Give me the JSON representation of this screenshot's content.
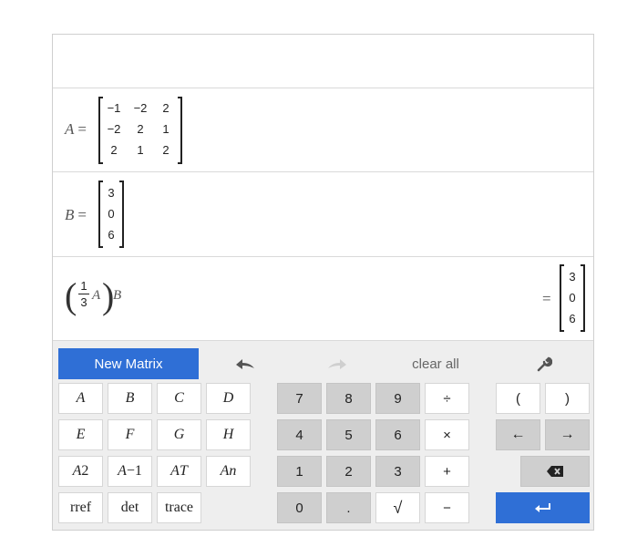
{
  "expressions": {
    "row1": {
      "name": "A",
      "equals": "=",
      "matrix": [
        [
          "−1",
          "−2",
          "2"
        ],
        [
          "−2",
          "2",
          "1"
        ],
        [
          "2",
          "1",
          "2"
        ]
      ]
    },
    "row2": {
      "name": "B",
      "equals": "=",
      "matrix": [
        [
          "3"
        ],
        [
          "0"
        ],
        [
          "6"
        ]
      ]
    },
    "row3": {
      "frac_num": "1",
      "frac_den": "3",
      "inner_var": "A",
      "outer_var": "B",
      "equals": "=",
      "result": [
        [
          "3"
        ],
        [
          "0"
        ],
        [
          "6"
        ]
      ]
    }
  },
  "toolbar": {
    "new_matrix": "New Matrix",
    "clear_all": "clear all"
  },
  "keys": {
    "A": "A",
    "B": "B",
    "C": "C",
    "D": "D",
    "E": "E",
    "F": "F",
    "G": "G",
    "H": "H",
    "A2_base": "A",
    "A2_sup": "2",
    "Ainv_base": "A",
    "Ainv_sup": "−1",
    "AT_base": "A",
    "AT_sup": "T",
    "An_base": "A",
    "An_sup": "n",
    "rref": "rref",
    "det": "det",
    "trace": "trace",
    "n7": "7",
    "n8": "8",
    "n9": "9",
    "div": "÷",
    "n4": "4",
    "n5": "5",
    "n6": "6",
    "mul": "×",
    "n1": "1",
    "n2": "2",
    "n3": "3",
    "plus": "+",
    "n0": "0",
    "dot": ".",
    "sqrt": "√",
    "minus": "−",
    "lparen": "(",
    "rparen": ")",
    "left": "←",
    "right": "→"
  },
  "colors": {
    "accent": "#2f6fd6",
    "keypad_bg": "#eeeeee",
    "gray_key": "#cfcfcf"
  },
  "icons": [
    "undo-icon",
    "redo-icon",
    "wrench-icon",
    "backspace-icon",
    "enter-icon"
  ]
}
